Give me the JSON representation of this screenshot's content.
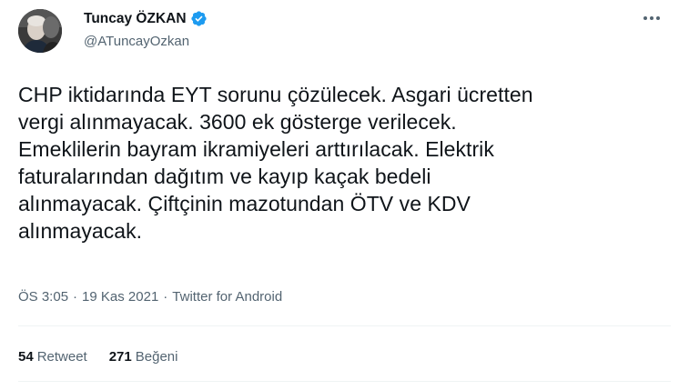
{
  "author": {
    "display_name": "Tuncay ÖZKAN",
    "handle": "@ATuncayOzkan",
    "verified": true,
    "avatar_icon": "profile-photo"
  },
  "more_icon": "more-options-icon",
  "tweet": {
    "text": "CHP iktidarında EYT sorunu çözülecek. Asgari ücretten\nvergi alınmayacak. 3600 ek gösterge verilecek.\nEmeklilerin bayram ikramiyeleri arttırılacak. Elektrik\nfaturalarından dağıtım ve kayıp kaçak bedeli\nalınmayacak. Çiftçinin mazotundan ÖTV ve KDV\nalınmayacak.",
    "time": "ÖS 3:05",
    "date": "19 Kas 2021",
    "source": "Twitter for Android",
    "separator": "·"
  },
  "stats": {
    "retweets_count": "54",
    "retweets_label": "Retweet",
    "likes_count": "271",
    "likes_label": "Beğeni"
  },
  "colors": {
    "verified_blue": "#1d9bf0",
    "secondary_text": "#536471",
    "primary_text": "#0f1419"
  }
}
